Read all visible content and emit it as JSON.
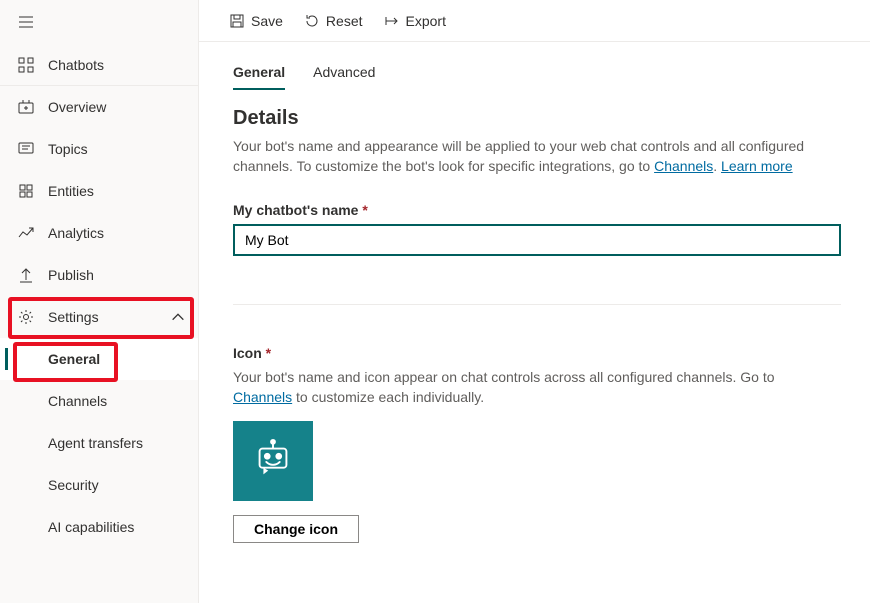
{
  "sidebar": {
    "chatbots": "Chatbots",
    "items": [
      {
        "label": "Overview"
      },
      {
        "label": "Topics"
      },
      {
        "label": "Entities"
      },
      {
        "label": "Analytics"
      },
      {
        "label": "Publish"
      }
    ],
    "settings": "Settings",
    "subitems": [
      {
        "label": "General"
      },
      {
        "label": "Channels"
      },
      {
        "label": "Agent transfers"
      },
      {
        "label": "Security"
      },
      {
        "label": "AI capabilities"
      }
    ]
  },
  "toolbar": {
    "save": "Save",
    "reset": "Reset",
    "export": "Export"
  },
  "tabs": {
    "general": "General",
    "advanced": "Advanced"
  },
  "details": {
    "heading": "Details",
    "desc_pre": "Your bot's name and appearance will be applied to your web chat controls and all configured channels. To customize the bot's look for specific integrations, go to ",
    "channels_link": "Channels",
    "desc_sep": ". ",
    "learn_more": "Learn more",
    "name_label": "My chatbot's name",
    "name_value": "My Bot",
    "icon_label": "Icon",
    "icon_desc_pre": "Your bot's name and icon appear on chat controls across all configured channels. Go to ",
    "icon_channels_link": "Channels",
    "icon_desc_post": " to customize each individually.",
    "change_icon": "Change icon"
  }
}
